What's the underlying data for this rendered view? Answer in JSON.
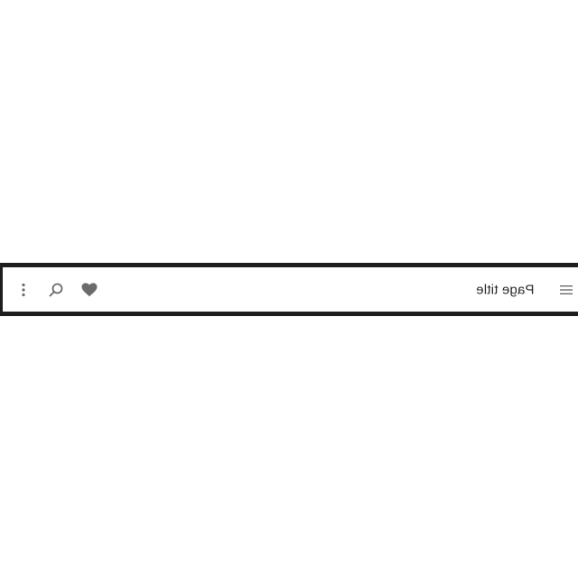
{
  "app_bar": {
    "title": "Page title",
    "icons": {
      "more": "more-vert-icon",
      "search": "search-icon",
      "favorite": "heart-icon",
      "menu": "menu-icon"
    },
    "colors": {
      "border": "#1e1e1e",
      "icon": "#6b6b6b",
      "text": "#2a2a2a"
    }
  }
}
